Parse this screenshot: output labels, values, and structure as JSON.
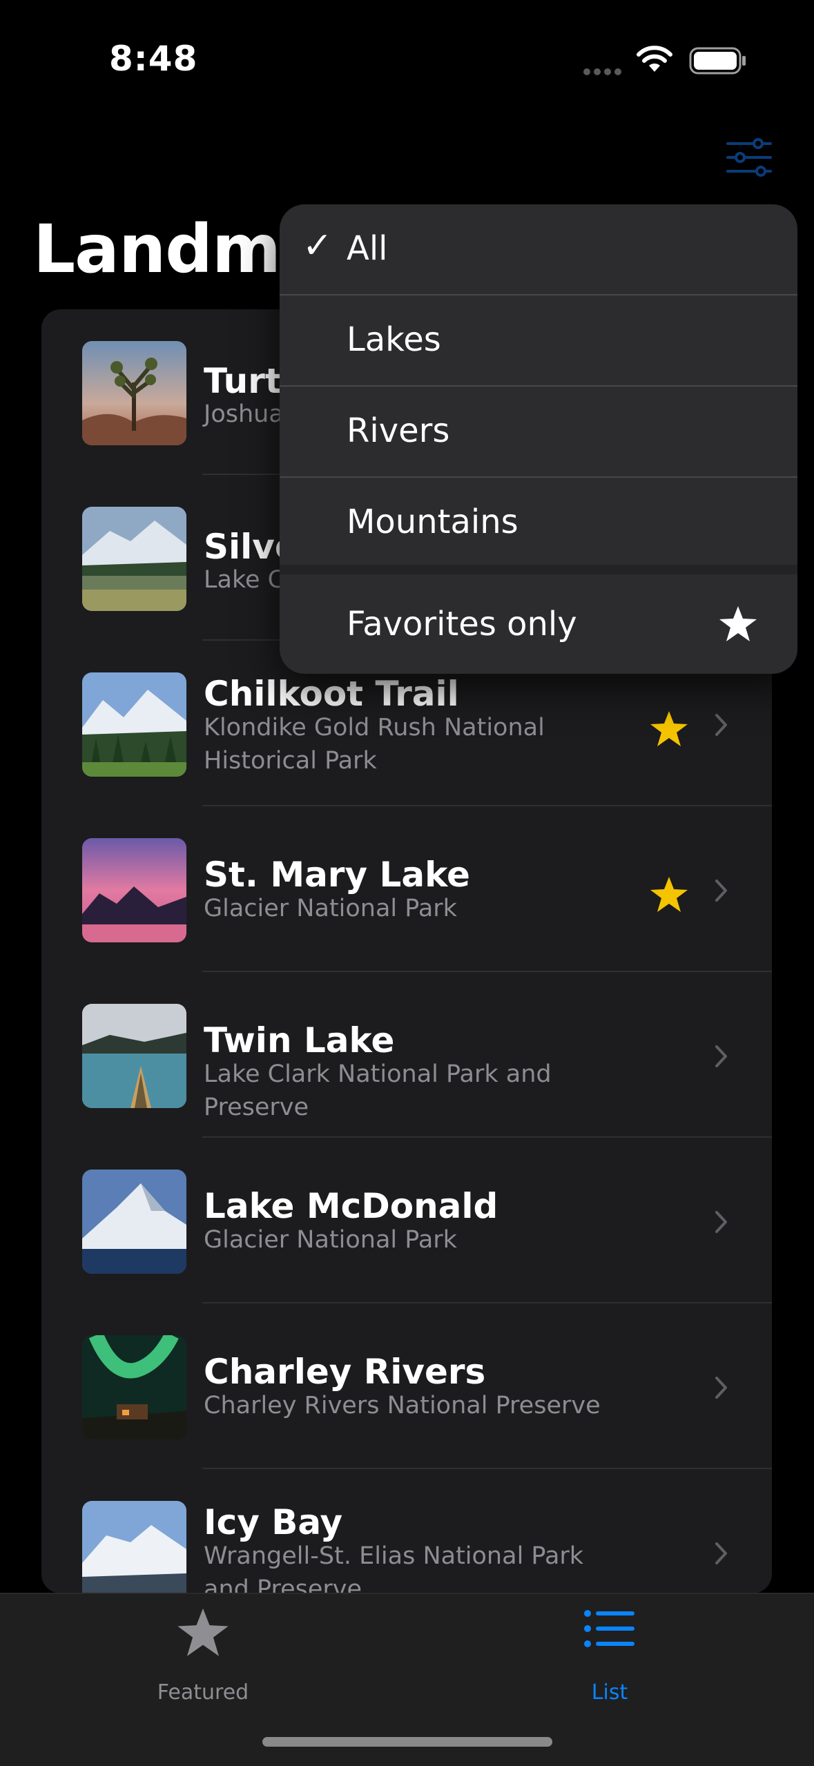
{
  "status_bar": {
    "time": "8:48"
  },
  "header": {
    "title": "Landmarks"
  },
  "colors": {
    "accent": "#0a84ff",
    "star": "#f5c400",
    "background": "#000000",
    "card": "#1c1c1e"
  },
  "filter_menu": {
    "icon": "slider-horizontal-icon",
    "items": [
      {
        "label": "All",
        "checked": true
      },
      {
        "label": "Lakes",
        "checked": false
      },
      {
        "label": "Rivers",
        "checked": false
      },
      {
        "label": "Mountains",
        "checked": false
      }
    ],
    "favorites_label": "Favorites only",
    "favorites_icon": "star-fill-icon"
  },
  "landmarks": [
    {
      "name": "Turtl",
      "park": "Joshua",
      "favorite": false
    },
    {
      "name": "Silve",
      "park": "Lake C",
      "favorite": false
    },
    {
      "name": "Chilkoot Trail",
      "park": "Klondike Gold Rush National Historical Park",
      "favorite": true
    },
    {
      "name": "St. Mary Lake",
      "park": "Glacier National Park",
      "favorite": true
    },
    {
      "name": "Twin Lake",
      "park": "Lake Clark National Park and Preserve",
      "favorite": false
    },
    {
      "name": "Lake McDonald",
      "park": "Glacier National Park",
      "favorite": false
    },
    {
      "name": "Charley Rivers",
      "park": "Charley Rivers National Preserve",
      "favorite": false
    },
    {
      "name": "Icy Bay",
      "park": "Wrangell-St. Elias National Park and Preserve",
      "favorite": false
    }
  ],
  "tab_bar": {
    "tabs": [
      {
        "label": "Featured",
        "icon": "star-icon",
        "selected": false
      },
      {
        "label": "List",
        "icon": "list-bullet-icon",
        "selected": true
      }
    ]
  }
}
